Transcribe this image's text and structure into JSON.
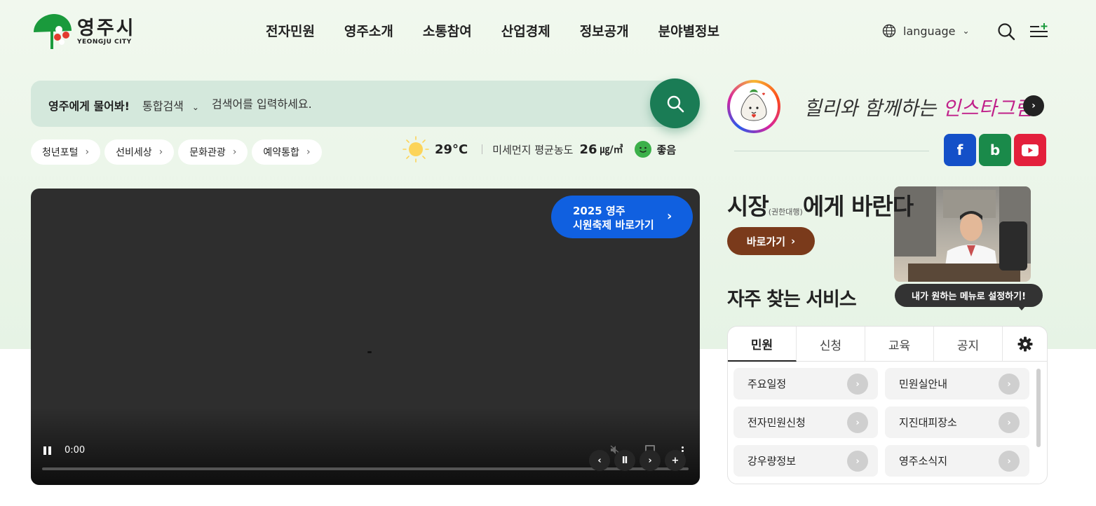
{
  "header": {
    "logo_kr": "영주시",
    "logo_en": "YEONGJU CITY",
    "nav": [
      "전자민원",
      "영주소개",
      "소통참여",
      "산업경제",
      "정보공개",
      "분야별정보"
    ],
    "language_label": "language"
  },
  "search": {
    "ask_label": "영주에게 물어봐!",
    "scope_label": "통합검색",
    "placeholder": "검색어를 입력하세요."
  },
  "quick_links": [
    "청년포털",
    "선비세상",
    "문화관광",
    "예약통합"
  ],
  "weather": {
    "temperature": "29°C",
    "dust_label": "미세먼지 평균농도",
    "dust_value": "26",
    "dust_unit": "㎍/㎥",
    "dust_status": "좋음"
  },
  "video": {
    "festival_line1": "2025 영주",
    "festival_line2": "시원축제 바로가기",
    "time": "0:00",
    "progress": 0
  },
  "instagram": {
    "text_prefix": "힐리와 함께하는 ",
    "text_highlight": "인스타그램"
  },
  "sns": [
    {
      "name": "facebook",
      "glyph": "f",
      "color": "#1450c8"
    },
    {
      "name": "blog",
      "glyph": "b",
      "color": "#1a8a4a"
    },
    {
      "name": "youtube",
      "glyph": "▶",
      "color": "#e3203c"
    }
  ],
  "mayor": {
    "title_main": "시장",
    "title_small": "(권한대행)",
    "title_rest": "에게 바란다",
    "button_label": "바로가기"
  },
  "services": {
    "title": "자주 찾는 서비스",
    "tooltip": "내가 원하는 메뉴로 설정하기!",
    "tabs": [
      "민원",
      "신청",
      "교육",
      "공지"
    ],
    "active_tab": "민원",
    "items": [
      "주요일정",
      "민원실안내",
      "전자민원신청",
      "지진대피장소",
      "강우량정보",
      "영주소식지"
    ]
  },
  "colors": {
    "brand_green": "#1a7c55",
    "festival_blue": "#1060e0",
    "mayor_brown": "#7a3a1b"
  }
}
